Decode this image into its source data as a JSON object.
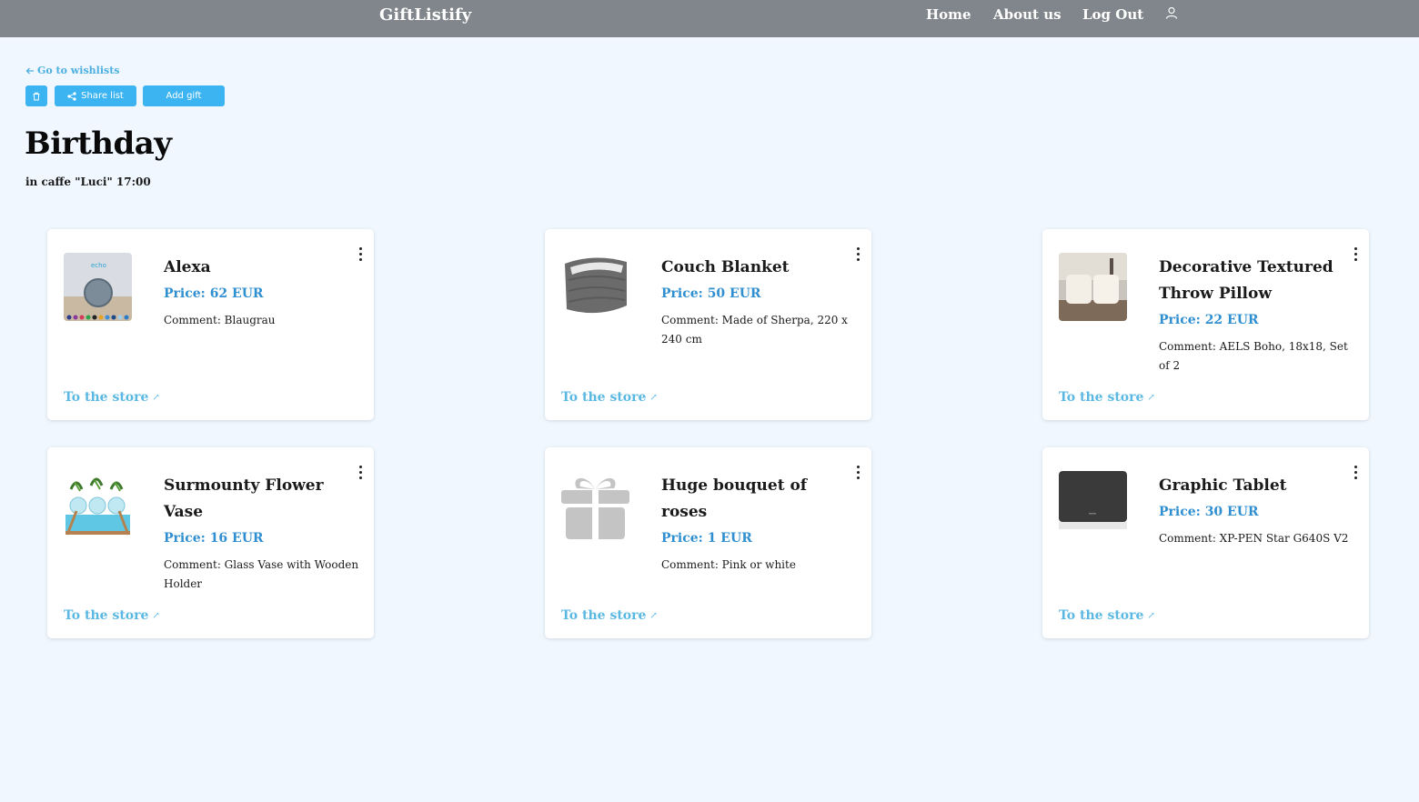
{
  "nav": {
    "brand": "GiftListify",
    "home": "Home",
    "about": "About us",
    "logout": "Log Out",
    "user_icon": "user-icon"
  },
  "toolbar": {
    "back_label": "Go to wishlists",
    "share_label": "Share list",
    "add_label": "Add gift",
    "delete_icon": "trash-icon"
  },
  "list": {
    "title": "Birthday",
    "subtitle": "in caffe \"Luci\" 17:00"
  },
  "gifts": [
    {
      "name": "Alexa",
      "price": "Price: 62 EUR",
      "comment": "Comment: Blaugrau",
      "link": "To the store"
    },
    {
      "name": "Couch Blanket",
      "price": "Price: 50 EUR",
      "comment": "Comment: Made of Sherpa, 220 x 240 cm",
      "link": "To the store"
    },
    {
      "name": "Decorative Textured Throw Pillow",
      "price": "Price: 22 EUR",
      "comment": "Comment: AELS Boho, 18x18, Set of 2",
      "link": "To the store"
    },
    {
      "name": "Surmounty Flower Vase",
      "price": "Price: 16 EUR",
      "comment": "Comment: Glass Vase with Wooden Holder",
      "link": "To the store"
    },
    {
      "name": "Huge bouquet of roses",
      "price": "Price: 1 EUR",
      "comment": "Comment: Pink or white",
      "link": "To the store"
    },
    {
      "name": "Graphic Tablet",
      "price": "Price: 30 EUR",
      "comment": "Comment: XP-PEN Star G640S V2",
      "link": "To the store"
    }
  ],
  "colors": {
    "navbar": "#80868b",
    "accent": "#3db4f2",
    "price": "#2f8fd0",
    "background": "#f0f7ff"
  }
}
